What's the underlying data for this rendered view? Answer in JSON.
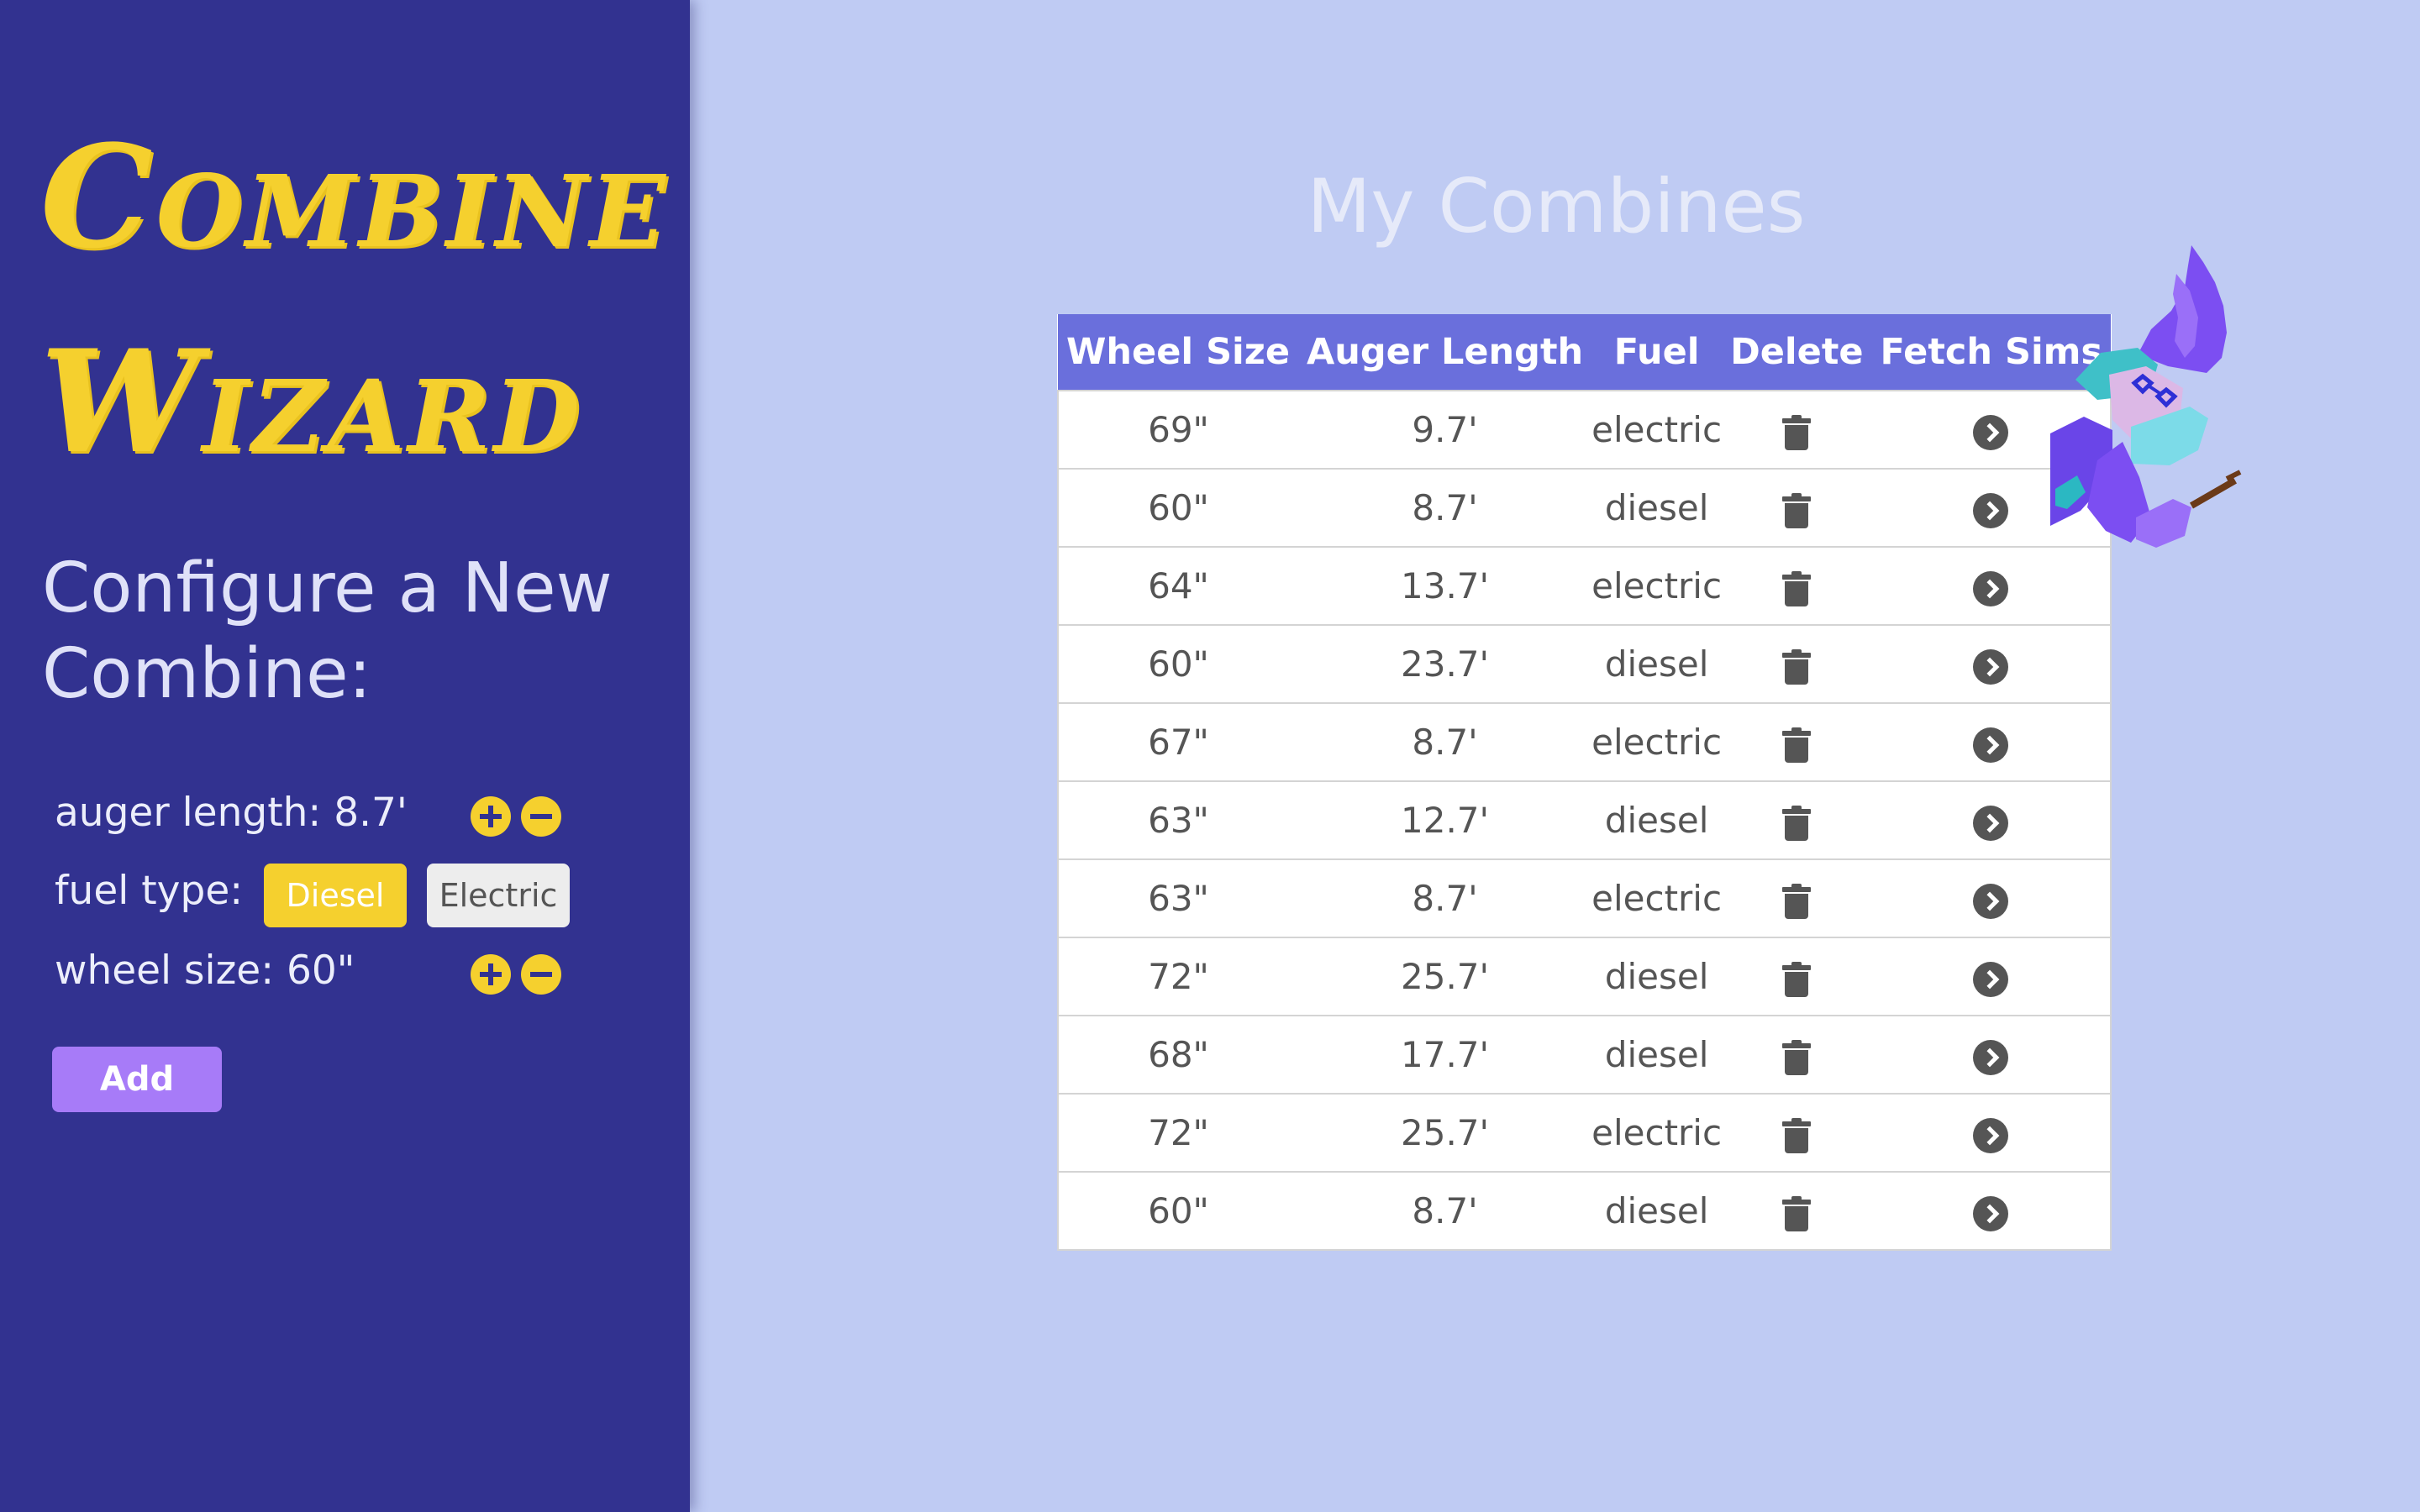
{
  "sidebar": {
    "logo_line1": "Combine",
    "logo_line2": "Wizard",
    "heading": "Configure a New Combine:",
    "auger": {
      "label": "auger length: 8.7'",
      "plus_icon": "plus-circle-icon",
      "minus_icon": "minus-circle-icon"
    },
    "fuel": {
      "label": "fuel type:",
      "options": [
        "Diesel",
        "Electric"
      ],
      "selected": "Diesel"
    },
    "wheel": {
      "label": "wheel size: 60\"",
      "plus_icon": "plus-circle-icon",
      "minus_icon": "minus-circle-icon"
    },
    "add_label": "Add"
  },
  "main": {
    "title": "My Combines",
    "columns": [
      "Wheel Size",
      "Auger Length",
      "Fuel",
      "Delete",
      "Fetch Sims"
    ],
    "row_icons": {
      "delete": "trash-icon",
      "fetch": "chevron-right-circle-icon"
    },
    "rows": [
      {
        "wheel": "69\"",
        "auger": "9.7'",
        "fuel": "electric"
      },
      {
        "wheel": "60\"",
        "auger": "8.7'",
        "fuel": "diesel"
      },
      {
        "wheel": "64\"",
        "auger": "13.7'",
        "fuel": "electric"
      },
      {
        "wheel": "60\"",
        "auger": "23.7'",
        "fuel": "diesel"
      },
      {
        "wheel": "67\"",
        "auger": "8.7'",
        "fuel": "electric"
      },
      {
        "wheel": "63\"",
        "auger": "12.7'",
        "fuel": "diesel"
      },
      {
        "wheel": "63\"",
        "auger": "8.7'",
        "fuel": "electric"
      },
      {
        "wheel": "72\"",
        "auger": "25.7'",
        "fuel": "diesel"
      },
      {
        "wheel": "68\"",
        "auger": "17.7'",
        "fuel": "diesel"
      },
      {
        "wheel": "72\"",
        "auger": "25.7'",
        "fuel": "electric"
      },
      {
        "wheel": "60\"",
        "auger": "8.7'",
        "fuel": "diesel"
      }
    ]
  },
  "colors": {
    "sidebar_bg": "#323290",
    "page_bg": "#bfcbf3",
    "accent_yellow": "#f5d02e",
    "table_header": "#6a6fdc",
    "add_button": "#a77bf8"
  }
}
